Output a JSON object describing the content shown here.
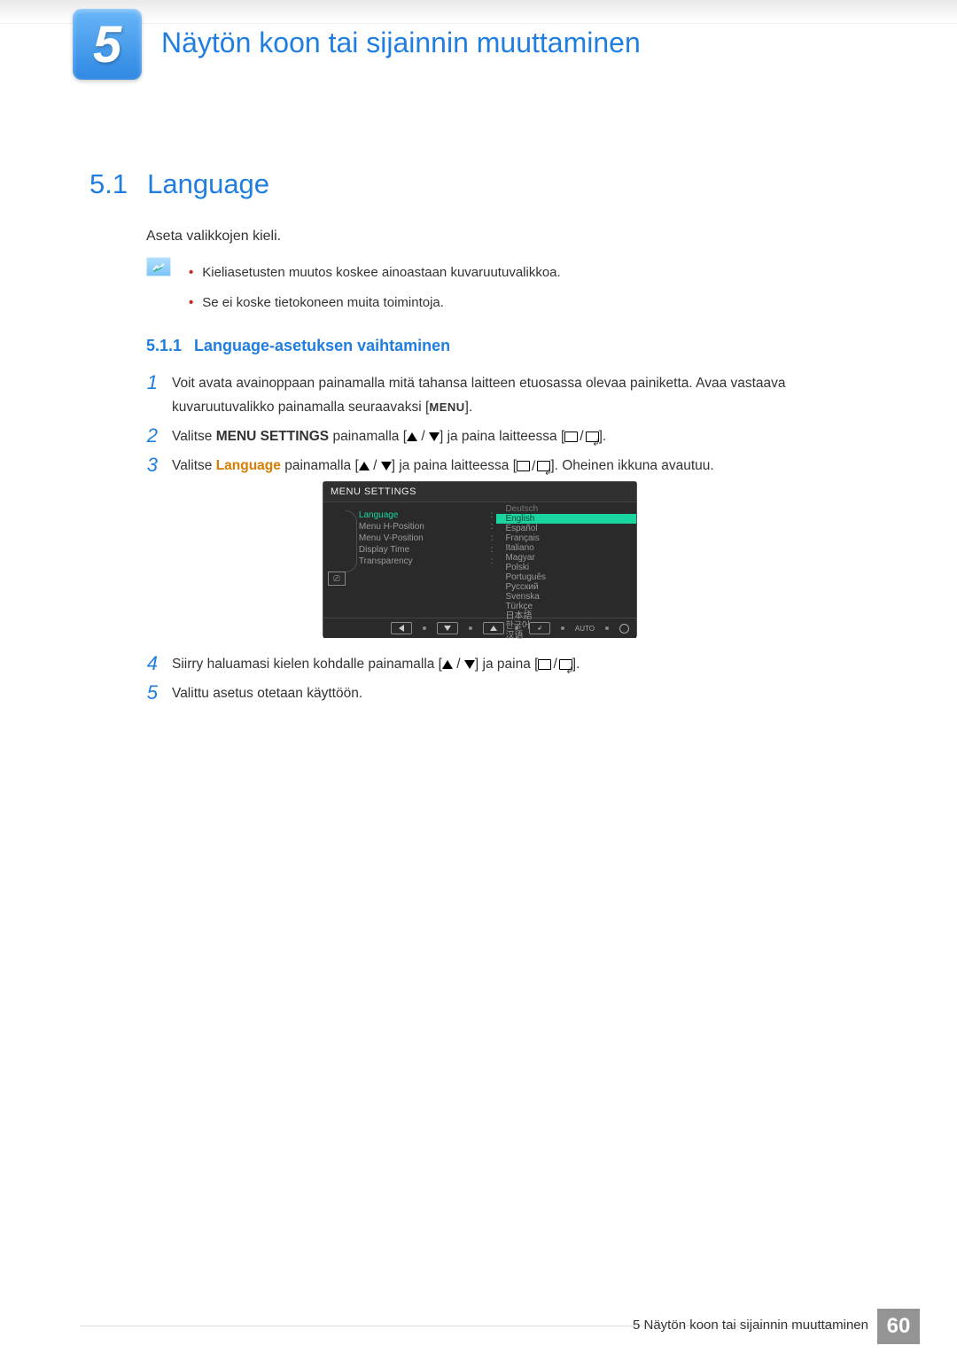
{
  "chapter": {
    "num": "5",
    "title": "Näytön koon tai sijainnin muuttaminen"
  },
  "section": {
    "num": "5.1",
    "title": "Language"
  },
  "intro": "Aseta valikkojen kieli.",
  "notes": {
    "items": [
      "Kieliasetusten muutos koskee ainoastaan kuvaruutuvalikkoa.",
      "Se ei koske tietokoneen muita toimintoja."
    ]
  },
  "subsection": {
    "num": "5.1.1",
    "title": "Language-asetuksen vaihtaminen"
  },
  "steps": {
    "s1_a": "Voit avata avainoppaan painamalla mitä tahansa laitteen etuosassa olevaa painiketta. Avaa vastaava kuvaruutuvalikko painamalla seuraavaksi [",
    "s1_menu": "MENU",
    "s1_b": "].",
    "s2_a": "Valitse ",
    "s2_bold": "MENU SETTINGS",
    "s2_b": " painamalla [",
    "s2_c": "] ja paina laitteessa [",
    "s2_d": "].",
    "s3_a": "Valitse ",
    "s3_orange": "Language",
    "s3_b": " painamalla [",
    "s3_c": "] ja paina laitteessa [",
    "s3_d": "]. Oheinen ikkuna avautuu.",
    "s4_a": "Siirry haluamasi kielen kohdalle painamalla [",
    "s4_b": "] ja paina [",
    "s4_c": "].",
    "s5": "Valittu asetus otetaan käyttöön."
  },
  "osd": {
    "title": "MENU SETTINGS",
    "menu": [
      {
        "label": "Language",
        "active": true
      },
      {
        "label": "Menu H-Position"
      },
      {
        "label": "Menu V-Position"
      },
      {
        "label": "Display Time"
      },
      {
        "label": "Transparency"
      }
    ],
    "langs": [
      {
        "label": "Deutsch",
        "dim": true
      },
      {
        "label": "English",
        "selected": true
      },
      {
        "label": "Español"
      },
      {
        "label": "Français"
      },
      {
        "label": "Italiano"
      },
      {
        "label": "Magyar"
      },
      {
        "label": "Polski"
      },
      {
        "label": "Português"
      },
      {
        "label": "Русский"
      },
      {
        "label": "Svenska"
      },
      {
        "label": "Türkçe"
      },
      {
        "label": "日本語"
      },
      {
        "label": "한국어"
      },
      {
        "label": "汉语"
      }
    ],
    "footer_auto": "AUTO"
  },
  "footer": {
    "text": "5 Näytön koon tai sijainnin muuttaminen",
    "page": "60"
  }
}
